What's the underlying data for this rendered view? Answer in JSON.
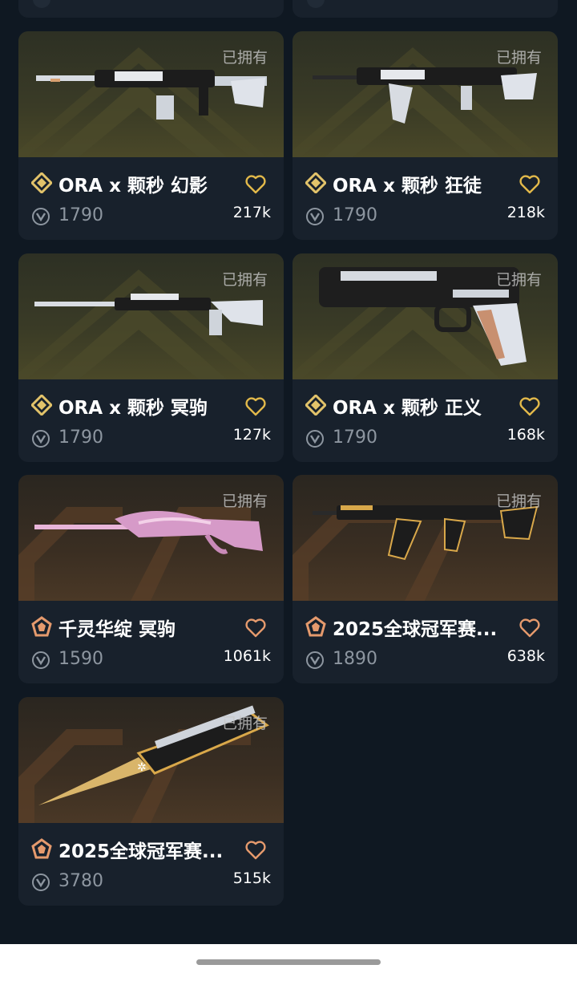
{
  "colors": {
    "background": "#0f1822",
    "card": "#18212c",
    "gold_rarity": "#e2c36a",
    "copper_rarity": "#e59a6d",
    "heart_gold": "#e2b94a",
    "heart_copper": "#e59a6d"
  },
  "cards": [
    {
      "name": "ORA x 颗秒 幻影",
      "price": "1790",
      "likes": "217k",
      "owned_label": "已拥有",
      "rarity": "gold-diamond-icon"
    },
    {
      "name": "ORA x 颗秒 狂徒",
      "price": "1790",
      "likes": "218k",
      "owned_label": "已拥有",
      "rarity": "gold-diamond-icon"
    },
    {
      "name": "ORA x 颗秒 冥驹",
      "price": "1790",
      "likes": "127k",
      "owned_label": "已拥有",
      "rarity": "gold-diamond-icon"
    },
    {
      "name": "ORA x 颗秒 正义",
      "price": "1790",
      "likes": "168k",
      "owned_label": "已拥有",
      "rarity": "gold-diamond-icon"
    },
    {
      "name": "千灵华绽 冥驹",
      "price": "1590",
      "likes": "1061k",
      "owned_label": "已拥有",
      "rarity": "copper-pentagon-icon"
    },
    {
      "name": "2025全球冠军赛...",
      "price": "1890",
      "likes": "638k",
      "owned_label": "已拥有",
      "rarity": "copper-pentagon-icon"
    },
    {
      "name": "2025全球冠军赛...",
      "price": "3780",
      "likes": "515k",
      "owned_label": "已拥有",
      "rarity": "copper-pentagon-icon"
    }
  ]
}
